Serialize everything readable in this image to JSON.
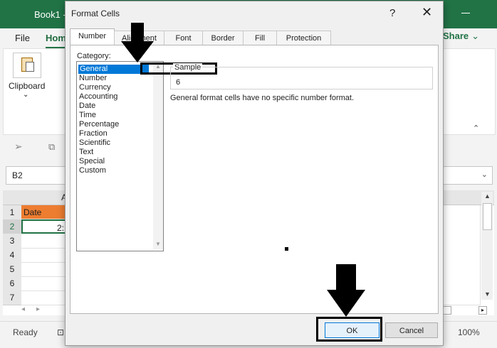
{
  "excel": {
    "title": "Book1 - ",
    "menu": {
      "file": "File",
      "home": "Home"
    },
    "share": "Share",
    "clipboard_label": "Clipboard",
    "namebox": "B2",
    "column_header": "A",
    "rows": [
      "1",
      "2",
      "3",
      "4",
      "5",
      "6",
      "7"
    ],
    "cell_a1": "Date",
    "cell_a2": "2:",
    "status": {
      "ready": "Ready",
      "zoom": "100%"
    }
  },
  "dialog": {
    "title": "Format Cells",
    "help_label": "?",
    "tabs": [
      "Number",
      "Alignment",
      "Font",
      "Border",
      "Fill",
      "Protection"
    ],
    "category_label": "Category:",
    "categories": [
      "General",
      "Number",
      "Currency",
      "Accounting",
      "Date",
      "Time",
      "Percentage",
      "Fraction",
      "Scientific",
      "Text",
      "Special",
      "Custom"
    ],
    "selected_category": "General",
    "sample_label": "Sample",
    "sample_value": "6",
    "description": "General format cells have no specific number format.",
    "ok_label": "OK",
    "cancel_label": "Cancel"
  },
  "colors": {
    "excel_green": "#217346",
    "selection_blue": "#0078d7",
    "header_orange": "#ed7d31",
    "annotation": "#000000"
  }
}
